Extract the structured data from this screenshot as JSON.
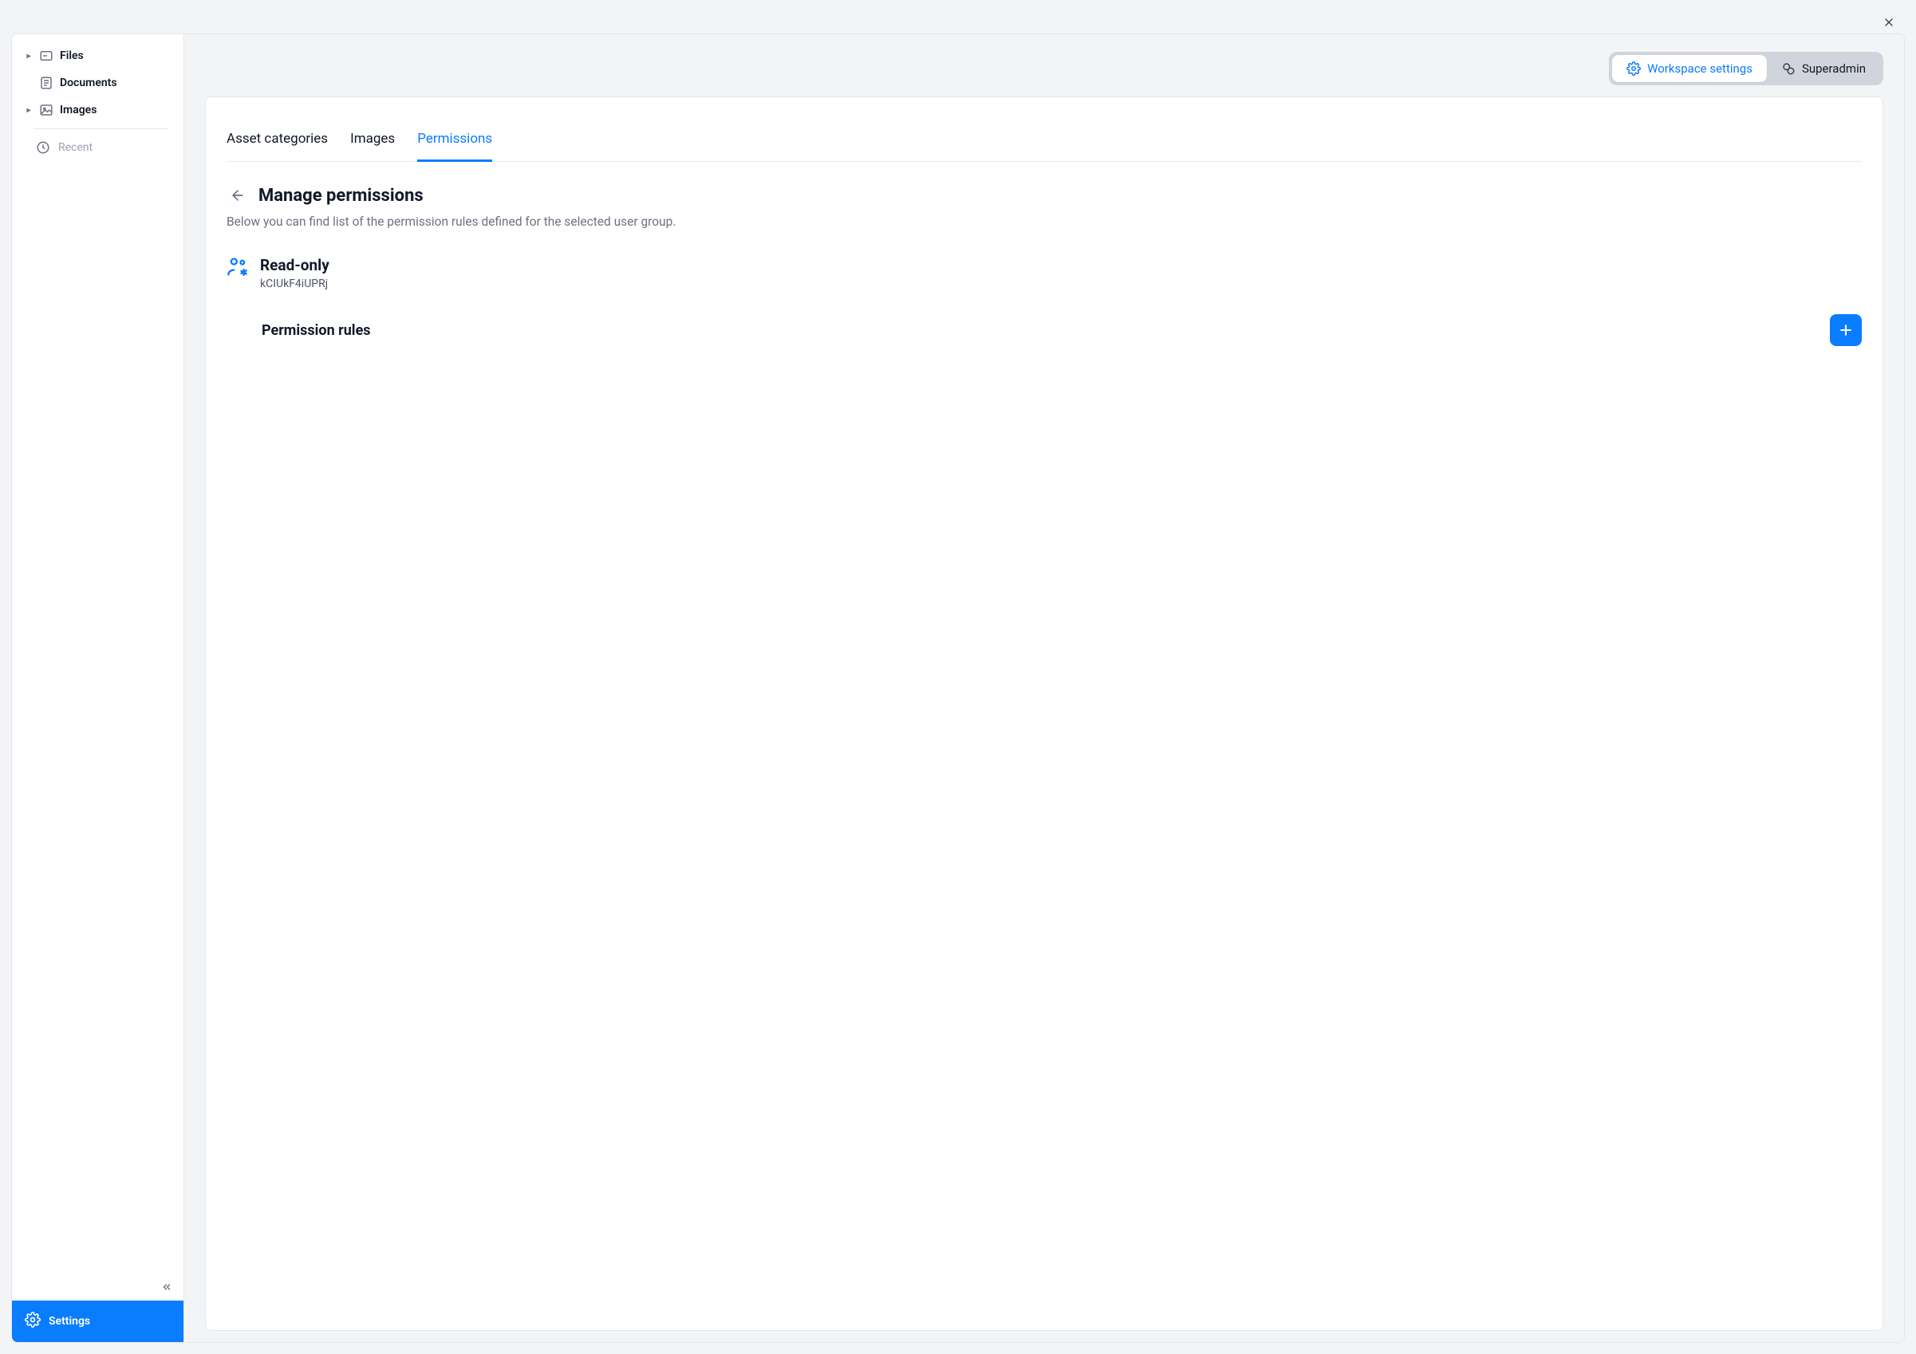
{
  "sidebar": {
    "items": [
      {
        "label": "Files"
      },
      {
        "label": "Documents"
      },
      {
        "label": "Images"
      }
    ],
    "recent_label": "Recent",
    "settings_label": "Settings"
  },
  "segmented": {
    "workspace": "Workspace settings",
    "superadmin": "Superadmin"
  },
  "tabs": {
    "asset_categories": "Asset categories",
    "images": "Images",
    "permissions": "Permissions"
  },
  "section": {
    "title": "Manage permissions",
    "description": "Below you can find list of the permission rules defined for the selected user group."
  },
  "group": {
    "name": "Read-only",
    "id": "kCIUkF4iUPRj"
  },
  "rules": {
    "heading": "Permission rules"
  }
}
